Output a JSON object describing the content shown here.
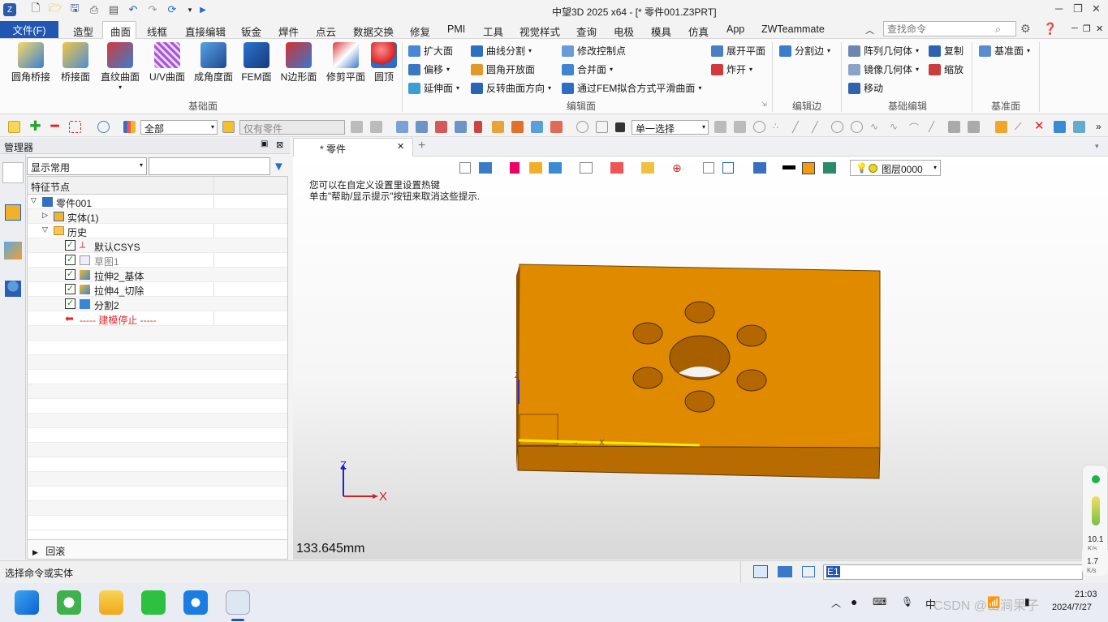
{
  "window": {
    "title": "中望3D 2025 x64 - [* 零件001.Z3PRT]"
  },
  "menu": {
    "file": "文件(F)",
    "tabs": [
      "造型",
      "曲面",
      "线框",
      "直接编辑",
      "钣金",
      "焊件",
      "点云",
      "数据交换",
      "修复",
      "PMI",
      "工具",
      "视觉样式",
      "查询",
      "电极",
      "模具",
      "仿真",
      "App",
      "ZWTeammate"
    ],
    "search_placeholder": "查找命令"
  },
  "ribbon": {
    "big_buttons": [
      "圆角桥接",
      "桥接面",
      "直纹曲面",
      "U/V曲面",
      "成角度面",
      "FEM面",
      "N边形面",
      "修剪平面",
      "圆顶"
    ],
    "group_basic": "基础面",
    "edit_col1": [
      "扩大面",
      "偏移",
      "延伸面"
    ],
    "edit_col2": [
      "曲线分割",
      "圆角开放面",
      "反转曲面方向"
    ],
    "edit_col3": [
      "修改控制点",
      "合并面",
      "通过FEM拟合方式平滑曲面"
    ],
    "edit_col4": [
      "展开平面",
      "炸开"
    ],
    "group_edit": "编辑面",
    "edge_btn": "分割边",
    "group_edge": "编辑边",
    "basic_edit_col1": [
      "阵列几何体",
      "镜像几何体",
      "移动"
    ],
    "basic_edit_col2": [
      "复制",
      "缩放"
    ],
    "group_basic_edit": "基础编辑",
    "datum_btn": "基准面",
    "group_datum": "基准面"
  },
  "toolbar": {
    "filter_all": "全部",
    "filter_parts": "仅有零件",
    "select_mode": "单一选择"
  },
  "manager": {
    "title": "管理器",
    "display_combo": "显示常用",
    "col_header": "特征节点",
    "tree": [
      {
        "label": "零件001",
        "level": 0
      },
      {
        "label": "实体(1)",
        "level": 1
      },
      {
        "label": "历史",
        "level": 1
      },
      {
        "label": "默认CSYS",
        "level": 2
      },
      {
        "label": "草图1",
        "level": 2
      },
      {
        "label": "拉伸2_基体",
        "level": 2
      },
      {
        "label": "拉伸4_切除",
        "level": 2
      },
      {
        "label": "分割2",
        "level": 2
      },
      {
        "label": "----- 建模停止 -----",
        "level": 2
      }
    ],
    "footer": "回滚"
  },
  "document": {
    "tab": "* 零件001.Z3PRT",
    "layer": "图层0000",
    "hint1": "您可以在自定义设置里设置热键",
    "hint2": "单击\"帮助/显示提示\"按钮来取消这些提示.",
    "measure": "133.645mm",
    "axis_x": "X",
    "axis_z": "Z"
  },
  "status": {
    "prompt": "选择命令或实体",
    "input": "E1"
  },
  "meter": {
    "up": "10.1",
    "up_unit": "K/s",
    "down": "1.7",
    "down_unit": "K/s"
  },
  "taskbar": {
    "time": "21:03",
    "date": "2024/7/27",
    "ime": "中",
    "watermark": "CSDN @山涧果子"
  },
  "colors": {
    "accent": "#1f57b3",
    "part": "#e08a00",
    "part_dark": "#b86c00"
  }
}
